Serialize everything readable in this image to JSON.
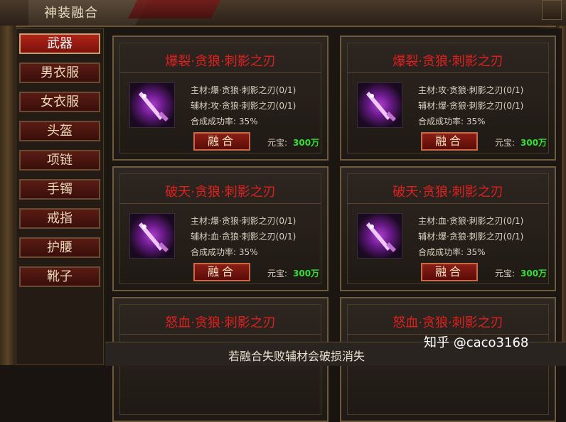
{
  "window": {
    "title": "神装融合"
  },
  "sidebar": {
    "items": [
      {
        "label": "武器",
        "active": true
      },
      {
        "label": "男衣服",
        "active": false
      },
      {
        "label": "女衣服",
        "active": false
      },
      {
        "label": "头盔",
        "active": false
      },
      {
        "label": "项链",
        "active": false
      },
      {
        "label": "手镯",
        "active": false
      },
      {
        "label": "戒指",
        "active": false
      },
      {
        "label": "护腰",
        "active": false
      },
      {
        "label": "靴子",
        "active": false
      }
    ]
  },
  "cards": [
    {
      "title": "爆裂·贪狼·刺影之刃",
      "main": "主材:爆·贪狼·刺影之刃(0/1)",
      "aux": "辅材:攻·贪狼·刺影之刃(0/1)",
      "rate": "合成成功率: 35%",
      "button": "融合",
      "price_label": "元宝:",
      "price": "300万"
    },
    {
      "title": "爆裂·贪狼·刺影之刃",
      "main": "主材:攻·贪狼·刺影之刃(0/1)",
      "aux": "辅材:爆·贪狼·刺影之刃(0/1)",
      "rate": "合成成功率: 35%",
      "button": "融合",
      "price_label": "元宝:",
      "price": "300万"
    },
    {
      "title": "破天·贪狼·刺影之刃",
      "main": "主材:爆·贪狼·刺影之刃(0/1)",
      "aux": "辅材:血·贪狼·刺影之刃(0/1)",
      "rate": "合成成功率: 35%",
      "button": "融合",
      "price_label": "元宝:",
      "price": "300万"
    },
    {
      "title": "破天·贪狼·刺影之刃",
      "main": "主材:血·贪狼·刺影之刃(0/1)",
      "aux": "辅材:爆·贪狼·刺影之刃(0/1)",
      "rate": "合成成功率: 35%",
      "button": "融合",
      "price_label": "元宝:",
      "price": "300万"
    },
    {
      "title": "怒血·贪狼·刺影之刃"
    },
    {
      "title": "怒血·贪狼·刺影之刃"
    }
  ],
  "footer": {
    "notice": "若融合失败辅材会破损消失"
  },
  "watermark": "知乎 @caco3168",
  "colors": {
    "title_red": "#e02020",
    "price_green": "#30e030",
    "button_red": "#8a1e14"
  }
}
